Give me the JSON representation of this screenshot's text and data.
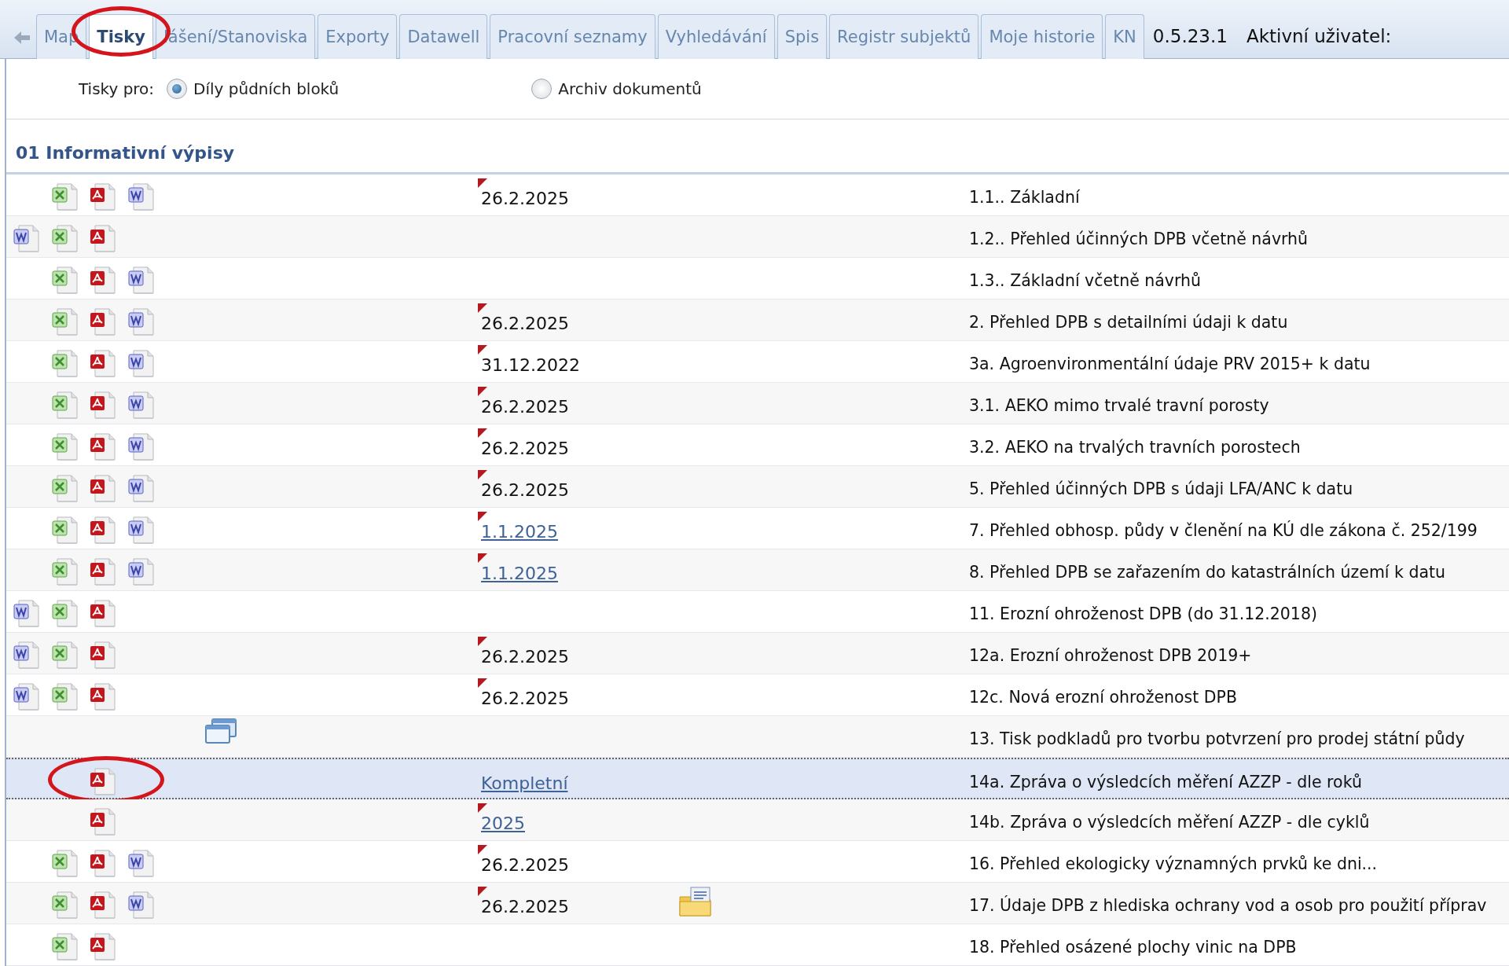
{
  "tabs": [
    {
      "label": "Map",
      "selected": false
    },
    {
      "label": "Tisky",
      "selected": true,
      "circled": true
    },
    {
      "label": "lášení/Stanoviska",
      "selected": false
    },
    {
      "label": "Exporty",
      "selected": false
    },
    {
      "label": "Datawell",
      "selected": false
    },
    {
      "label": "Pracovní seznamy",
      "selected": false
    },
    {
      "label": "Vyhledávání",
      "selected": false
    },
    {
      "label": "Spis",
      "selected": false
    },
    {
      "label": "Registr subjektů",
      "selected": false
    },
    {
      "label": "Moje historie",
      "selected": false
    },
    {
      "label": "KN",
      "selected": false
    }
  ],
  "version": "0.5.23.1",
  "user_label": "Aktivní uživatel:",
  "print_for": {
    "label": "Tisky pro:",
    "options": [
      {
        "label": "Díly půdních bloků",
        "selected": true
      },
      {
        "label": "Archiv dokumentů",
        "selected": false
      }
    ]
  },
  "section": {
    "title": "01 Informativní výpisy",
    "rows": [
      {
        "icons": [
          {
            "kind": "excel"
          },
          {
            "kind": "pdf"
          },
          {
            "kind": "word"
          }
        ],
        "date": {
          "text": "26.2.2025",
          "kind": "plain",
          "flag": true
        },
        "title": "1.1.. Základní",
        "selected": false
      },
      {
        "icons": [
          {
            "kind": "word"
          },
          {
            "kind": "excel"
          },
          {
            "kind": "pdf"
          }
        ],
        "title": "1.2.. Přehled účinných DPB včetně návrhů",
        "selected": false
      },
      {
        "icons": [
          {
            "kind": "excel"
          },
          {
            "kind": "pdf"
          },
          {
            "kind": "word"
          }
        ],
        "title": "1.3.. Základní včetně návrhů",
        "selected": false
      },
      {
        "icons": [
          {
            "kind": "excel"
          },
          {
            "kind": "pdf"
          },
          {
            "kind": "word"
          }
        ],
        "date": {
          "text": "26.2.2025",
          "kind": "plain",
          "flag": true
        },
        "title": "2. Přehled DPB s detailními údaji k datu",
        "selected": false
      },
      {
        "icons": [
          {
            "kind": "excel"
          },
          {
            "kind": "pdf"
          },
          {
            "kind": "word"
          }
        ],
        "date": {
          "text": "31.12.2022",
          "kind": "plain",
          "flag": true
        },
        "title": "3a. Agroenvironmentální údaje PRV 2015+ k datu",
        "selected": false
      },
      {
        "icons": [
          {
            "kind": "excel"
          },
          {
            "kind": "pdf"
          },
          {
            "kind": "word"
          }
        ],
        "date": {
          "text": "26.2.2025",
          "kind": "plain",
          "flag": true
        },
        "title": "3.1. AEKO mimo trvalé travní porosty",
        "selected": false
      },
      {
        "icons": [
          {
            "kind": "excel"
          },
          {
            "kind": "pdf"
          },
          {
            "kind": "word"
          }
        ],
        "date": {
          "text": "26.2.2025",
          "kind": "plain",
          "flag": true
        },
        "title": "3.2. AEKO na trvalých travních porostech",
        "selected": false
      },
      {
        "icons": [
          {
            "kind": "excel"
          },
          {
            "kind": "pdf"
          },
          {
            "kind": "word"
          }
        ],
        "date": {
          "text": "26.2.2025",
          "kind": "plain",
          "flag": true
        },
        "title": "5. Přehled účinných DPB s údaji LFA/ANC k datu",
        "selected": false
      },
      {
        "icons": [
          {
            "kind": "excel"
          },
          {
            "kind": "pdf"
          },
          {
            "kind": "word"
          }
        ],
        "date": {
          "text": "1.1.2025",
          "kind": "link",
          "flag": true
        },
        "title": "7. Přehled obhosp. půdy v členění na KÚ dle zákona č. 252/199",
        "selected": false
      },
      {
        "icons": [
          {
            "kind": "excel"
          },
          {
            "kind": "pdf"
          },
          {
            "kind": "word"
          }
        ],
        "date": {
          "text": "1.1.2025",
          "kind": "link",
          "flag": true
        },
        "title": "8. Přehled DPB se zařazením do katastrálních území k datu",
        "selected": false
      },
      {
        "icons": [
          {
            "kind": "word"
          },
          {
            "kind": "excel"
          },
          {
            "kind": "pdf"
          }
        ],
        "title": "11. Erozní ohroženost DPB (do 31.12.2018)",
        "selected": false
      },
      {
        "icons": [
          {
            "kind": "word"
          },
          {
            "kind": "excel"
          },
          {
            "kind": "pdf"
          }
        ],
        "date": {
          "text": "26.2.2025",
          "kind": "plain",
          "flag": true
        },
        "title": "12a. Erozní ohroženost DPB 2019+",
        "selected": false
      },
      {
        "icons": [
          {
            "kind": "word"
          },
          {
            "kind": "excel"
          },
          {
            "kind": "pdf"
          }
        ],
        "date": {
          "text": "26.2.2025",
          "kind": "plain",
          "flag": true
        },
        "title": "12c. Nová erozní ohroženost DPB",
        "selected": false
      },
      {
        "icons": [
          {
            "kind": "windows"
          }
        ],
        "title": "13. Tisk podkladů pro tvorbu potvrzení pro prodej státní půdy",
        "selected": false
      },
      {
        "icons": [
          {
            "kind": "pdf"
          }
        ],
        "date": {
          "text": "Kompletní",
          "kind": "link",
          "flag": false
        },
        "title": "14a. Zpráva o výsledcích měření AZZP - dle roků",
        "selected": true,
        "circled": true
      },
      {
        "icons": [
          {
            "kind": "pdf"
          }
        ],
        "date": {
          "text": "2025",
          "kind": "link",
          "flag": true
        },
        "title": "14b. Zpráva o výsledcích měření AZZP - dle cyklů",
        "selected": false
      },
      {
        "icons": [
          {
            "kind": "excel"
          },
          {
            "kind": "pdf"
          },
          {
            "kind": "word"
          }
        ],
        "date": {
          "text": "26.2.2025",
          "kind": "plain",
          "flag": true
        },
        "title": "16. Přehled ekologicky významných prvků ke dni...",
        "selected": false
      },
      {
        "icons": [
          {
            "kind": "excel"
          },
          {
            "kind": "pdf"
          },
          {
            "kind": "word"
          }
        ],
        "date": {
          "text": "26.2.2025",
          "kind": "plain",
          "flag": true
        },
        "extra_icon": {
          "kind": "folder"
        },
        "title": "17. Údaje DPB z hlediska ochrany vod a osob pro použití příprav",
        "selected": false
      },
      {
        "icons": [
          {
            "kind": "excel"
          },
          {
            "kind": "pdf"
          }
        ],
        "title": "18. Přehled osázené plochy vinic na DPB",
        "selected": false
      }
    ]
  }
}
